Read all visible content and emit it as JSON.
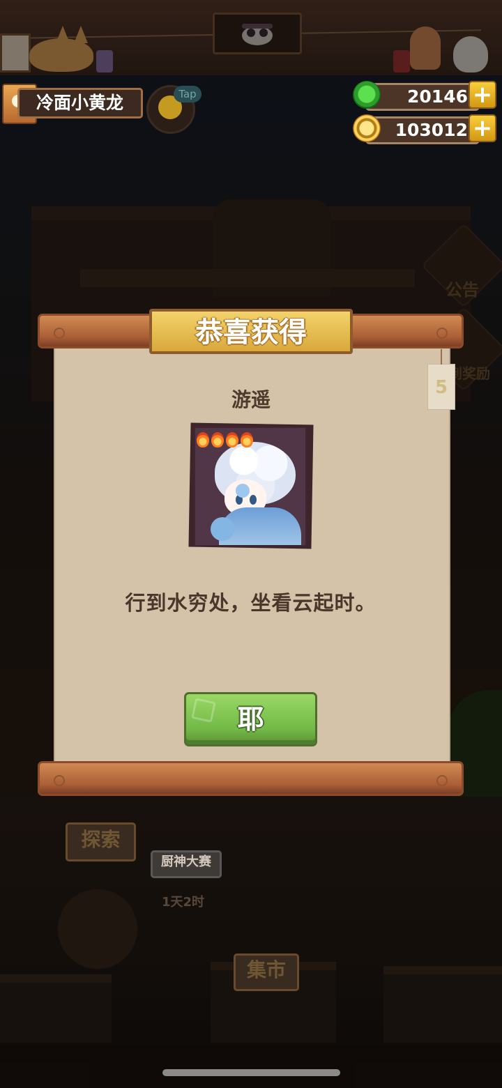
{
  "player": {
    "name": "冷面小黄龙",
    "tap_label": "Tap"
  },
  "currencies": {
    "jade": "20146",
    "coins": "103012"
  },
  "side_panels": [
    {
      "label": "公告",
      "icon": "notice-icon"
    },
    {
      "label": "签到奖励",
      "icon": "gift-icon"
    }
  ],
  "dialog": {
    "title": "恭喜获得",
    "tag_number": "5",
    "character_name": "游遥",
    "rarity_flames": 4,
    "quote": "行到水穷处，坐看云起时。",
    "confirm_label": "耶"
  },
  "background_labels": {
    "explore": "探索",
    "contest": "厨神大赛",
    "contest_timer": "1天2时",
    "market": "集市"
  },
  "colors": {
    "confirm_green": "#7bbf4d",
    "title_gold": "#f1c85f",
    "dialog_paper": "#d4c3a8",
    "wood": "#b8683c"
  }
}
